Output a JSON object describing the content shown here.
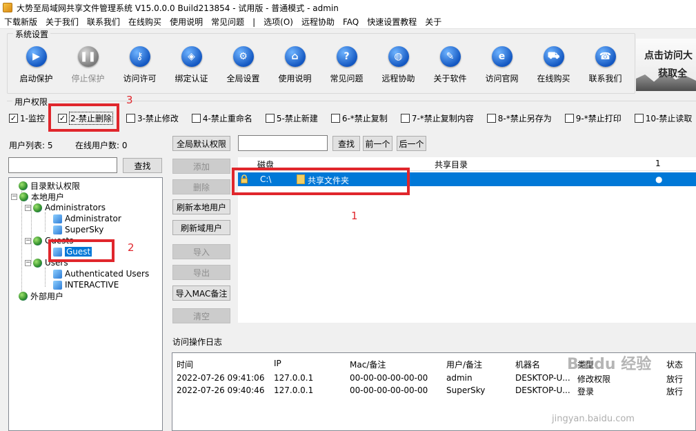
{
  "window": {
    "title": "大势至局域网共享文件管理系统 V15.0.0.0 Build213854 - 试用版 - 普通模式 - admin"
  },
  "menu": [
    "下载新版",
    "关于我们",
    "联系我们",
    "在线购买",
    "使用说明",
    "常见问题",
    "|",
    "选项(O)",
    "远程协助",
    "FAQ",
    "快速设置教程",
    "关于"
  ],
  "system": {
    "group_label": "系统设置",
    "tools": [
      {
        "label": "启动保护",
        "icon": "play-icon",
        "disabled": false
      },
      {
        "label": "停止保护",
        "icon": "pause-icon",
        "disabled": true
      },
      {
        "label": "访问许可",
        "icon": "key-icon",
        "disabled": false
      },
      {
        "label": "绑定认证",
        "icon": "shield-icon",
        "disabled": false
      },
      {
        "label": "全局设置",
        "icon": "gear-icon",
        "disabled": false
      },
      {
        "label": "使用说明",
        "icon": "graduation-cap-icon",
        "disabled": false
      },
      {
        "label": "常见问题",
        "icon": "question-icon",
        "disabled": false
      },
      {
        "label": "远程协助",
        "icon": "globe-icon",
        "disabled": false
      },
      {
        "label": "关于软件",
        "icon": "document-icon",
        "disabled": false
      },
      {
        "label": "访问官网",
        "icon": "ie-icon",
        "disabled": false
      },
      {
        "label": "在线购买",
        "icon": "cart-icon",
        "disabled": false
      },
      {
        "label": "联系我们",
        "icon": "phone-icon",
        "disabled": false
      }
    ]
  },
  "ad": {
    "line1": "点击访问大",
    "line2": "获取全"
  },
  "permissions": {
    "group_label": "用户权限",
    "items": [
      {
        "label": "1-监控",
        "checked": true
      },
      {
        "label": "2-禁止删除",
        "checked": true
      },
      {
        "label": "3-禁止修改",
        "checked": false
      },
      {
        "label": "4-禁止重命名",
        "checked": false
      },
      {
        "label": "5-禁止新建",
        "checked": false
      },
      {
        "label": "6-*禁止复制",
        "checked": false
      },
      {
        "label": "7-*禁止复制内容",
        "checked": false
      },
      {
        "label": "8-*禁止另存为",
        "checked": false
      },
      {
        "label": "9-*禁止打印",
        "checked": false
      },
      {
        "label": "10-禁止读取",
        "checked": false
      }
    ]
  },
  "annotations": {
    "n1": "1",
    "n2": "2",
    "n3": "3"
  },
  "users": {
    "list_label": "用户列表: 5",
    "online_label": "在线用户数: 0",
    "search_value": "",
    "search_button": "查找",
    "tree": {
      "dir_default": "目录默认权限",
      "local_users": "本地用户",
      "administrators": "Administrators",
      "administrator": "Administrator",
      "supersky": "SuperSky",
      "guests": "Guests",
      "guest": "Guest",
      "users_group": "Users",
      "auth_users": "Authenticated Users",
      "interactive": "INTERACTIVE",
      "external": "外部用户"
    }
  },
  "actions": {
    "global_default": "全局默认权限",
    "add": "添加",
    "delete": "删除",
    "refresh_local": "刷新本地用户",
    "refresh_domain": "刷新域用户",
    "import": "导入",
    "export": "导出",
    "import_mac": "导入MAC备注",
    "clear": "清空"
  },
  "share": {
    "search_value": "",
    "search_button": "查找",
    "prev_button": "前一个",
    "next_button": "后一个",
    "col_disk": "磁盘",
    "col_dir": "共享目录",
    "col_1": "1",
    "row": {
      "disk": "C:\\",
      "dir": "共享文件夹",
      "mark": "●"
    }
  },
  "log": {
    "label": "访问操作日志",
    "headers": [
      "时间",
      "IP",
      "Mac/备注",
      "用户/备注",
      "机器名",
      "类型",
      "状态"
    ],
    "rows": [
      [
        "2022-07-26 09:41:06",
        "127.0.0.1",
        "00-00-00-00-00-00",
        "admin",
        "DESKTOP-U...",
        "修改权限",
        "放行"
      ],
      [
        "2022-07-26 09:40:46",
        "127.0.0.1",
        "00-00-00-00-00-00",
        "SuperSky",
        "DESKTOP-U...",
        "登录",
        "放行"
      ]
    ]
  },
  "watermark": {
    "text": "Baidu 经验",
    "url": "jingyan.baidu.com"
  },
  "colors": {
    "selection": "#0078d7",
    "annotation_red": "#e0262c"
  }
}
